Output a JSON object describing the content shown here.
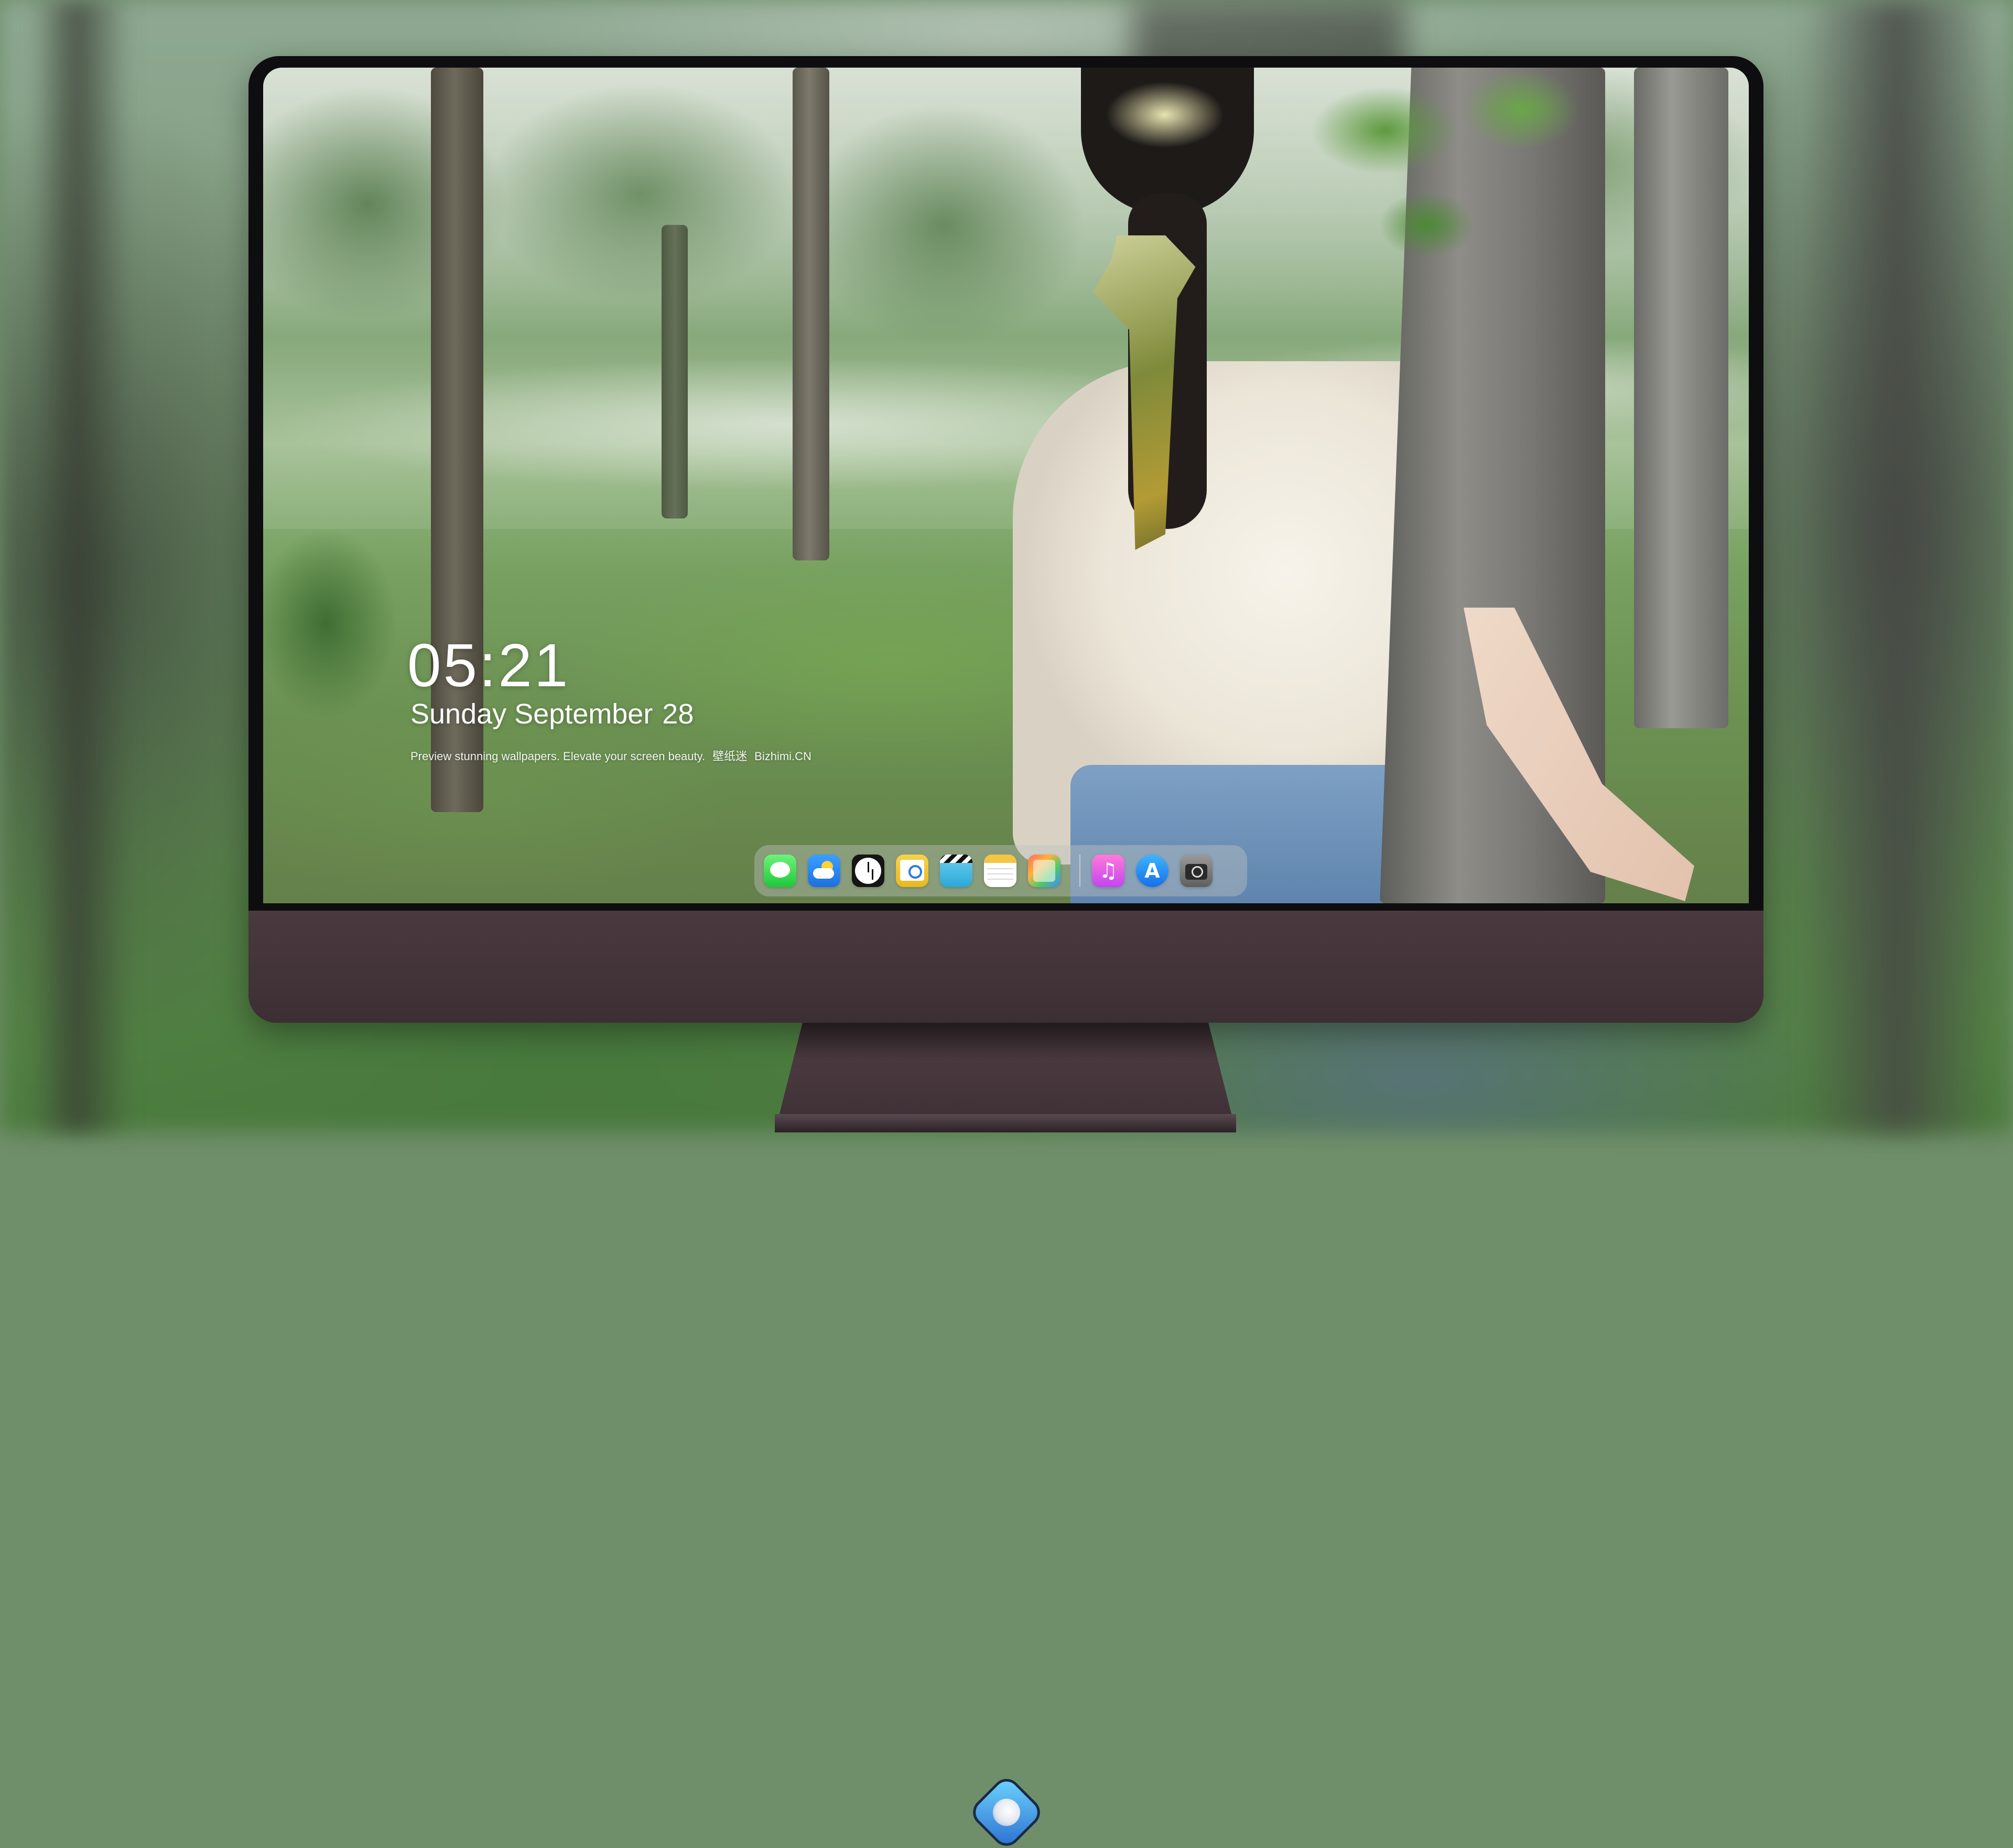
{
  "lockscreen": {
    "time": "05:21",
    "weekday_month": "Sunday September",
    "day": "28",
    "tagline": "Preview stunning wallpapers. Elevate your screen beauty.",
    "tagline_brand": "壁纸迷",
    "tagline_site": "Bizhimi.CN"
  },
  "dock": {
    "apps": [
      {
        "name": "Messages",
        "icon": "messages-icon"
      },
      {
        "name": "Weather",
        "icon": "weather-icon"
      },
      {
        "name": "Clock",
        "icon": "clock-icon"
      },
      {
        "name": "Preview",
        "icon": "preview-icon"
      },
      {
        "name": "Clips",
        "icon": "clapperboard-icon"
      },
      {
        "name": "Notes",
        "icon": "notes-icon"
      },
      {
        "name": "Photo Booth",
        "icon": "photos-icon"
      },
      {
        "name": "Music",
        "icon": "music-icon"
      },
      {
        "name": "App Store",
        "icon": "app-store-icon"
      },
      {
        "name": "Camera",
        "icon": "camera-icon"
      }
    ]
  },
  "monitor": {
    "logo": "wallpaper-app-logo-icon",
    "chin_color": "#3f3136",
    "bezel_color": "#0e0d0f"
  },
  "colors": {
    "text": "#ffffff",
    "dock_bg": "rgba(190,196,190,0.42)"
  }
}
